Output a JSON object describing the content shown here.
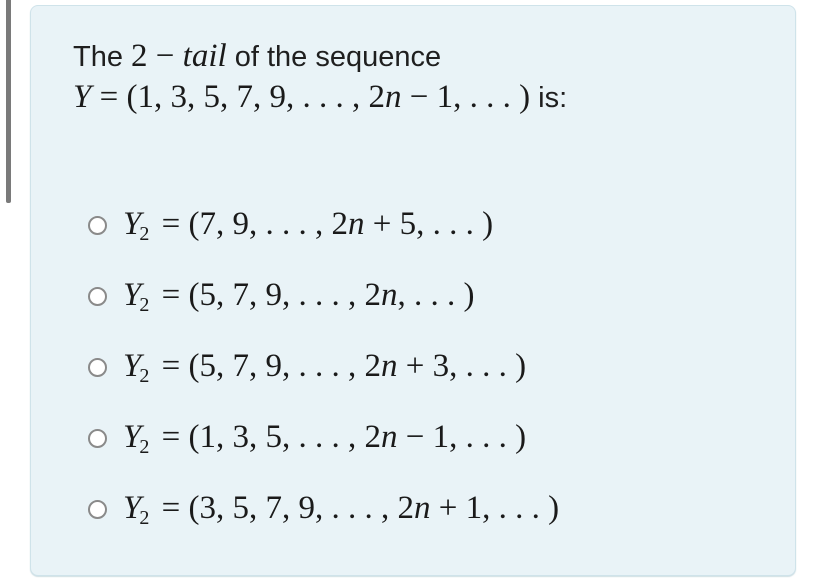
{
  "question": {
    "line1_prefix": "The ",
    "line1_math_number": "2",
    "line1_math_op": " − ",
    "line1_math_word": "tail",
    "line1_suffix": " of the sequence",
    "line2_var": "Y",
    "line2_math": " = (1, 3, 5, 7, 9, . . . , 2",
    "line2_n": "n",
    "line2_math_end": " − 1, . . . )",
    "line2_suffix": " is:"
  },
  "options": [
    {
      "var": "Y",
      "sub": "2",
      "before_n": " = (7, 9, . . . , 2",
      "n": "n",
      "after_n": " + 5, . . . )",
      "selected": false
    },
    {
      "var": "Y",
      "sub": "2",
      "before_n": " = (5, 7, 9, . . . , 2",
      "n": "n",
      "after_n": ", . . . )",
      "selected": false
    },
    {
      "var": "Y",
      "sub": "2",
      "before_n": " = (5, 7, 9, . . . , 2",
      "n": "n",
      "after_n": " + 3, . . . )",
      "selected": false
    },
    {
      "var": "Y",
      "sub": "2",
      "before_n": " = (1, 3, 5, . . . , 2",
      "n": "n",
      "after_n": " − 1, . . . )",
      "selected": false
    },
    {
      "var": "Y",
      "sub": "2",
      "before_n": " = (3, 5, 7, 9, . . . , 2",
      "n": "n",
      "after_n": " + 1, . . . )",
      "selected": false
    }
  ],
  "colors": {
    "card_background": "#e9f3f7",
    "card_border": "#cfe3ea",
    "text": "#1a1a1a",
    "radio_border": "#8a8a8a"
  }
}
